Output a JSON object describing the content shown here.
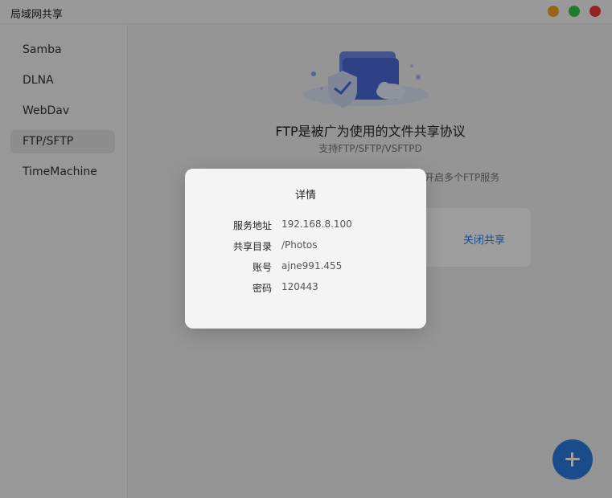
{
  "window": {
    "title": "局域网共享"
  },
  "sidebar": {
    "items": [
      {
        "label": "Samba",
        "active": false
      },
      {
        "label": "DLNA",
        "active": false
      },
      {
        "label": "WebDav",
        "active": false
      },
      {
        "label": "FTP/SFTP",
        "active": true
      },
      {
        "label": "TimeMachine",
        "active": false
      }
    ]
  },
  "main": {
    "headline": "FTP是被广为使用的文件共享协议",
    "subline": "支持FTP/SFTP/VSFTPD",
    "hint": "开启多个FTP服务",
    "card_action": "关闭共享"
  },
  "icons": {
    "hero": "folder-shield-illustration",
    "fab": "plus-icon"
  },
  "colors": {
    "accent": "#2b7be0",
    "traffic_orange": "#f5a623",
    "traffic_green": "#34c84a",
    "traffic_red": "#ee3b3b"
  },
  "dialog": {
    "title": "详情",
    "rows": [
      {
        "key": "服务地址",
        "value": "192.168.8.100"
      },
      {
        "key": "共享目录",
        "value": "/Photos"
      },
      {
        "key": "账号",
        "value": "ajne991.455"
      },
      {
        "key": "密码",
        "value": "120443"
      }
    ]
  }
}
